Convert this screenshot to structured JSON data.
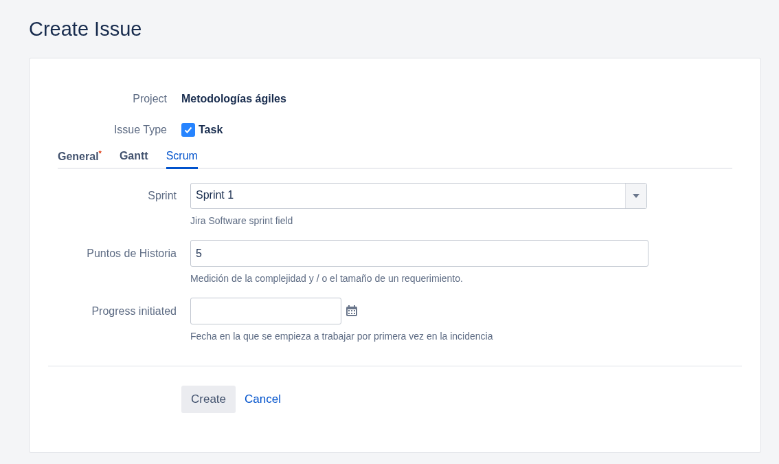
{
  "title": "Create Issue",
  "project": {
    "label": "Project",
    "value": "Metodologías ágiles"
  },
  "issue_type": {
    "label": "Issue Type",
    "value": "Task",
    "checked": true
  },
  "tabs": [
    {
      "label": "General",
      "required_mark": "*",
      "selected": false
    },
    {
      "label": "Gantt",
      "selected": false
    },
    {
      "label": "Scrum",
      "selected": true
    }
  ],
  "fields": [
    {
      "kind": "select",
      "label": "Sprint",
      "value": "Sprint 1",
      "help": "Jira Software sprint field"
    },
    {
      "kind": "text",
      "label": "Puntos de Historia",
      "value": "5",
      "help": "Medición de la complejidad y / o el tamaño de un requerimiento."
    },
    {
      "kind": "date",
      "label": "Progress initiated",
      "help": "Fecha en la que se empieza a trabajar por primera vez en la incidencia"
    }
  ],
  "buttons": {
    "create": "Create",
    "cancel": "Cancel"
  }
}
